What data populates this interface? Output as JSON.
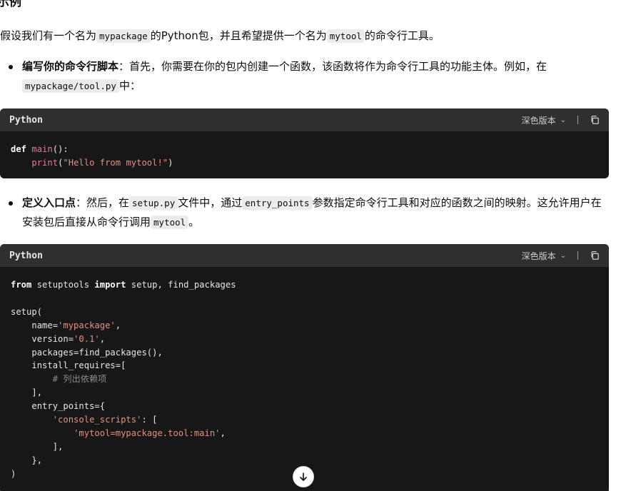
{
  "heading": "示例",
  "intro": {
    "part1": "假设我们有一个名为",
    "code1": "mypackage",
    "part2": "的Python包，并且希望提供一个名为",
    "code2": "mytool",
    "part3": "的命令行工具。"
  },
  "bullet1": {
    "bold": "编写你的命令行脚本",
    "text": "：首先，你需要在你的包内创建一个函数，该函数将作为命令行工具的功能主体。例如，在",
    "code": "mypackage/tool.py",
    "tail": "中："
  },
  "bullet2": {
    "bold": "定义入口点",
    "text1": "：然后，在",
    "code1": "setup.py",
    "text2": "文件中，通过",
    "code2": "entry_points",
    "text3": "参数指定命令行工具和对应的函数之间的映射。这允许用户在安装包后直接从命令行调用",
    "code3": "mytool",
    "tail": "。"
  },
  "code_block_1": {
    "language": "Python",
    "theme_label": "深色版本",
    "lines": {
      "l1_kw": "def",
      "l1_fn": "main",
      "l1_rest": "():",
      "l2_fn": "print",
      "l2_open": "(",
      "l2_str": "\"Hello from mytool!\"",
      "l2_close": ")"
    }
  },
  "code_block_2": {
    "language": "Python",
    "theme_label": "深色版本",
    "lines": {
      "l1_kw1": "from",
      "l1_mid": "setuptools",
      "l1_kw2": "import",
      "l1_rest": "setup, find_packages",
      "l3": "setup(",
      "l4_key": "name=",
      "l4_str": "'mypackage'",
      "l5_key": "version=",
      "l5_str": "'0.1'",
      "l6": "packages=find_packages(),",
      "l7": "install_requires=[",
      "l8_cm": "# 列出依赖项",
      "l9": "],",
      "l10": "entry_points={",
      "l11_str": "'console_scripts'",
      "l11_rest": ": [",
      "l12_str": "'mytool=mypackage.tool:main'",
      "l13": "],",
      "l14": "},",
      "l15": ")"
    }
  },
  "icons": {
    "copy": "copy-icon",
    "chevron": "chevron-down-icon",
    "scroll_down": "arrow-down-icon"
  }
}
